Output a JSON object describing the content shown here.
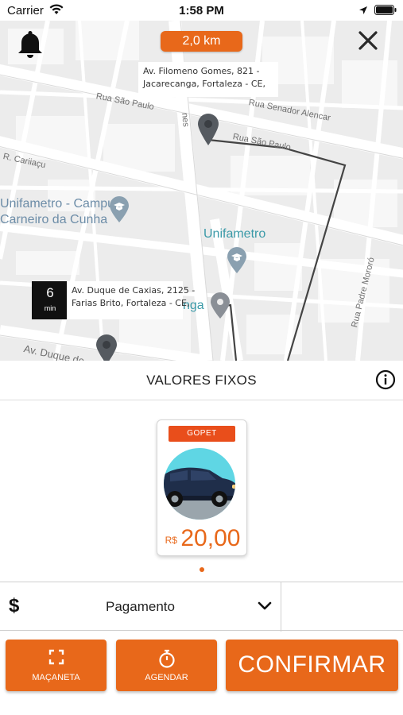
{
  "status_bar": {
    "carrier": "Carrier",
    "time": "1:58 PM"
  },
  "map": {
    "distance": "2,0 km",
    "destination_address": [
      "Av. Filomeno Gomes, 821 -",
      "Jacarecanga, Fortaleza - CE,"
    ],
    "origin_address": [
      "Av. Duque de Caxias, 2125 -",
      "Farias Brito, Fortaleza - CE,"
    ],
    "eta": {
      "value": "6",
      "unit": "min"
    },
    "streets": [
      "Rua São Paulo",
      "Rua Senador Alencar",
      "Rua São Paulo",
      "R. Cariiaçu",
      "Rua Padre Mororó",
      "Av. Duque de",
      "nes",
      "nga"
    ],
    "pois": [
      "Unifametro - Campus",
      "Carneiro da Cunha",
      "Unifametro"
    ]
  },
  "header": {
    "title": "VALORES FIXOS"
  },
  "vehicle": {
    "category": "GOPET",
    "currency": "R$",
    "price": "20,00"
  },
  "payment": {
    "symbol": "$",
    "label": "Pagamento"
  },
  "actions": {
    "maca": "MAÇANETA",
    "agendar": "AGENDAR",
    "confirm": "CONFIRMAR"
  },
  "colors": {
    "accent": "#e8681a",
    "badge": "#e94e1b"
  },
  "icons": [
    "wifi-icon",
    "location-arrow-icon",
    "battery-icon",
    "bell-icon",
    "close-icon",
    "map-pin-icon",
    "graduation-cap-icon",
    "info-icon",
    "chevron-down-icon",
    "expand-icon",
    "timer-icon"
  ]
}
